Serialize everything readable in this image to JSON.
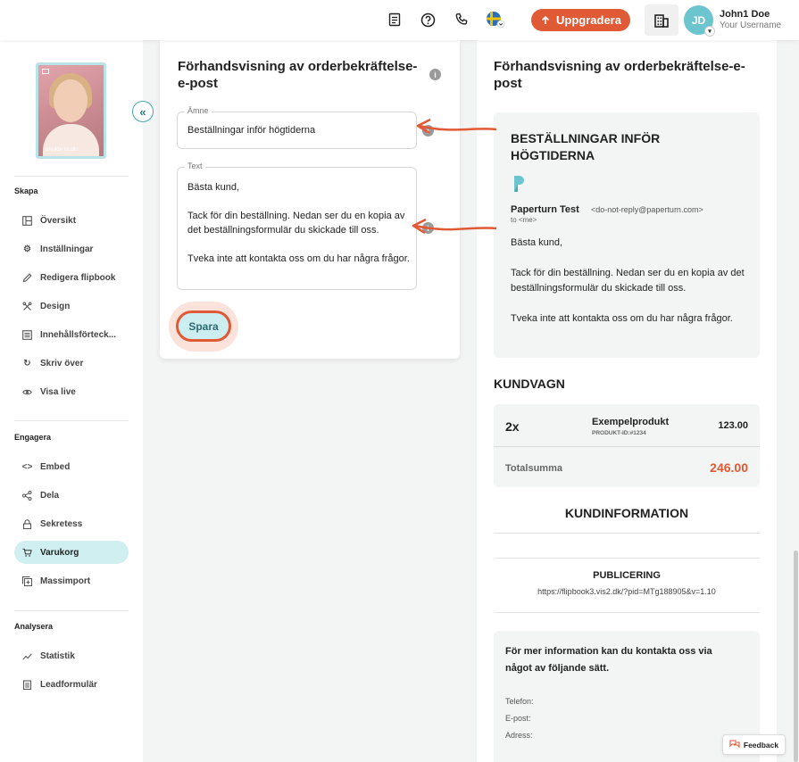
{
  "topbar": {
    "upgrade_label": "Uppgradera",
    "user_name": "John1 Doe",
    "user_sub": "Your Username",
    "avatar_initials": "JD",
    "icons": [
      "document-icon",
      "help-icon",
      "phone-icon",
      "sweden-flag-icon",
      "building-icon"
    ]
  },
  "sidebar": {
    "thumb_text": "ansikte studio",
    "sections": {
      "skapa": "Skapa",
      "engagera": "Engagera",
      "analysera": "Analysera"
    },
    "skapa_items": [
      {
        "label": "Översikt",
        "icon": "overview-icon"
      },
      {
        "label": "Inställningar",
        "icon": "gear-icon"
      },
      {
        "label": "Redigera flipbook",
        "icon": "pencil-icon"
      },
      {
        "label": "Design",
        "icon": "design-icon"
      },
      {
        "label": "Innehållsförteck...",
        "icon": "list-icon"
      },
      {
        "label": "Skriv över",
        "icon": "refresh-icon"
      },
      {
        "label": "Visa live",
        "icon": "eye-icon"
      }
    ],
    "engagera_items": [
      {
        "label": "Embed",
        "icon": "code-icon"
      },
      {
        "label": "Dela",
        "icon": "share-icon"
      },
      {
        "label": "Sekretess",
        "icon": "lock-icon"
      },
      {
        "label": "Varukorg",
        "icon": "cart-icon",
        "active": true
      },
      {
        "label": "Massimport",
        "icon": "import-icon"
      }
    ],
    "analysera_items": [
      {
        "label": "Statistik",
        "icon": "stats-icon"
      },
      {
        "label": "Leadformulär",
        "icon": "form-icon"
      }
    ]
  },
  "form": {
    "title": "Förhandsvisning av orderbekräftelse-e-post",
    "subject_label": "Ämne",
    "subject_value": "Beställningar inför högtiderna",
    "text_label": "Text",
    "text_value": "Bästa kund,\n\nTack för din beställning. Nedan ser du en kopia av det beställningsformulär du skickade till oss.\n\nTveka inte att kontakta oss om du har några frågor.",
    "save_label": "Spara"
  },
  "preview": {
    "title": "Förhandsvisning av orderbekräftelse-e-post",
    "email_subject": "BESTÄLLNINGAR INFÖR HÖGTIDERNA",
    "sender_name": "Paperturn Test",
    "sender_email": "<do-not-reply@paperturn.com>",
    "sender_to": "to <me>",
    "body": "Bästa kund,\n\nTack för din beställning. Nedan ser du en kopia av det beställningsformulär du skickade till oss.\n\nTveka inte att kontakta oss om du har några frågor.",
    "cart_title": "KUNDVAGN",
    "cart_qty": "2x",
    "cart_product": "Exempelprodukt",
    "cart_product_id": "PRODUKT-ID:#1234",
    "cart_price": "123.00",
    "cart_total_label": "Totalsumma",
    "cart_total": "246.00",
    "customer_info_title": "KUNDINFORMATION",
    "publication_title": "PUBLICERING",
    "publication_url": "https://flipbook3.vis2.dk/?pid=MTg188905&v=1.10",
    "contact_title": "För mer information kan du kontakta oss via något av följande sätt.",
    "contact_phone": "Telefon:",
    "contact_email": "E-post:",
    "contact_address": "Adress:"
  },
  "feedback_label": "Feedback",
  "colors": {
    "accent_orange": "#e05a36",
    "teal": "#6cc4cf",
    "active_nav": "#cfeff1"
  }
}
